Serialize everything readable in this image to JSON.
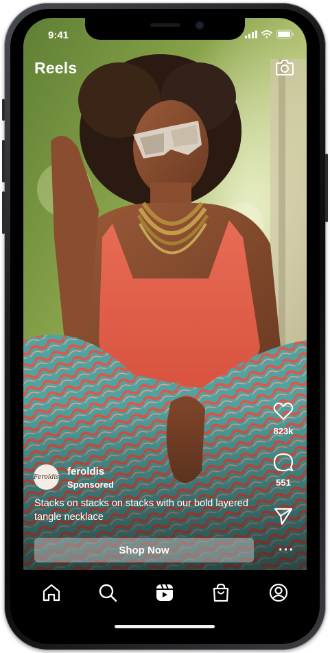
{
  "status_bar": {
    "time": "9:41"
  },
  "header": {
    "title": "Reels",
    "camera_icon": "camera-icon"
  },
  "post": {
    "account": {
      "avatar_text": "Feroldis",
      "username": "feroldis",
      "label": "Sponsored"
    },
    "caption": "Stacks on stacks on stacks with our bold layered tangle necklace",
    "cta_label": "Shop Now"
  },
  "actions": {
    "like_count": "823k",
    "comment_count": "551",
    "more_label": "···"
  },
  "tab_bar": {
    "items": [
      {
        "name": "home",
        "icon": "home-icon"
      },
      {
        "name": "search",
        "icon": "search-icon"
      },
      {
        "name": "reels",
        "icon": "reels-icon",
        "active": true
      },
      {
        "name": "shop",
        "icon": "shopping-bag-icon"
      },
      {
        "name": "profile",
        "icon": "profile-icon"
      }
    ]
  },
  "colors": {
    "accent_top": "#ff5a4a",
    "background": "#000000",
    "text": "#ffffff"
  }
}
